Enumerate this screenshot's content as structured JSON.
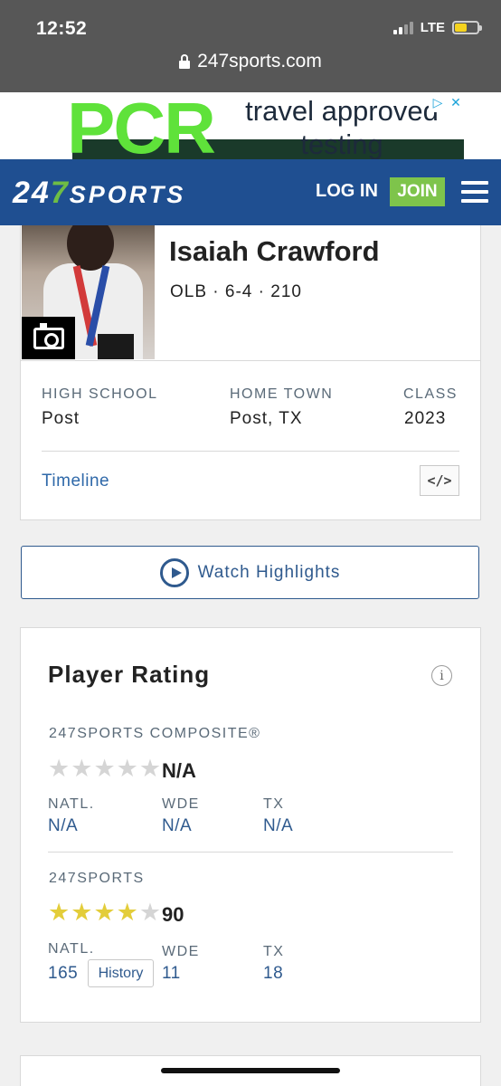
{
  "status_bar": {
    "time": "12:52",
    "network": "LTE"
  },
  "url_bar": {
    "domain": "247sports.com"
  },
  "ad": {
    "headline": "PCR",
    "text_line1": "travel approved",
    "text_line2": "testing"
  },
  "nav": {
    "logo_part1": "24",
    "logo_part2": "7",
    "logo_part3": "SPORTS",
    "login_label": "LOG IN",
    "join_label": "JOIN"
  },
  "player": {
    "name": "Isaiah Crawford",
    "meta": "OLB · 6-4 · 210",
    "high_school_label": "HIGH SCHOOL",
    "high_school": "Post",
    "home_town_label": "HOME TOWN",
    "home_town": "Post, TX",
    "class_label": "CLASS",
    "class": "2023",
    "timeline_label": "Timeline",
    "embed_label": "</>"
  },
  "watch_highlights_label": "Watch Highlights",
  "rating": {
    "title": "Player Rating",
    "info_label": "i",
    "composite": {
      "label": "247SPORTS COMPOSITE®",
      "stars": 0,
      "score": "N/A",
      "ranks": [
        {
          "label": "NATL.",
          "value": "N/A"
        },
        {
          "label": "WDE",
          "value": "N/A"
        },
        {
          "label": "TX",
          "value": "N/A"
        }
      ]
    },
    "sports247": {
      "label": "247SPORTS",
      "stars": 4,
      "score": "90",
      "ranks": [
        {
          "label": "NATL.",
          "value": "165"
        },
        {
          "label": "WDE",
          "value": "11"
        },
        {
          "label": "TX",
          "value": "18"
        }
      ],
      "history_label": "History"
    }
  },
  "colors": {
    "nav_blue": "#1f4f91",
    "join_green": "#7ec44b",
    "link_blue": "#2f5a8e",
    "star_gold": "#e3cd3a",
    "star_empty": "#d5d5d5"
  }
}
